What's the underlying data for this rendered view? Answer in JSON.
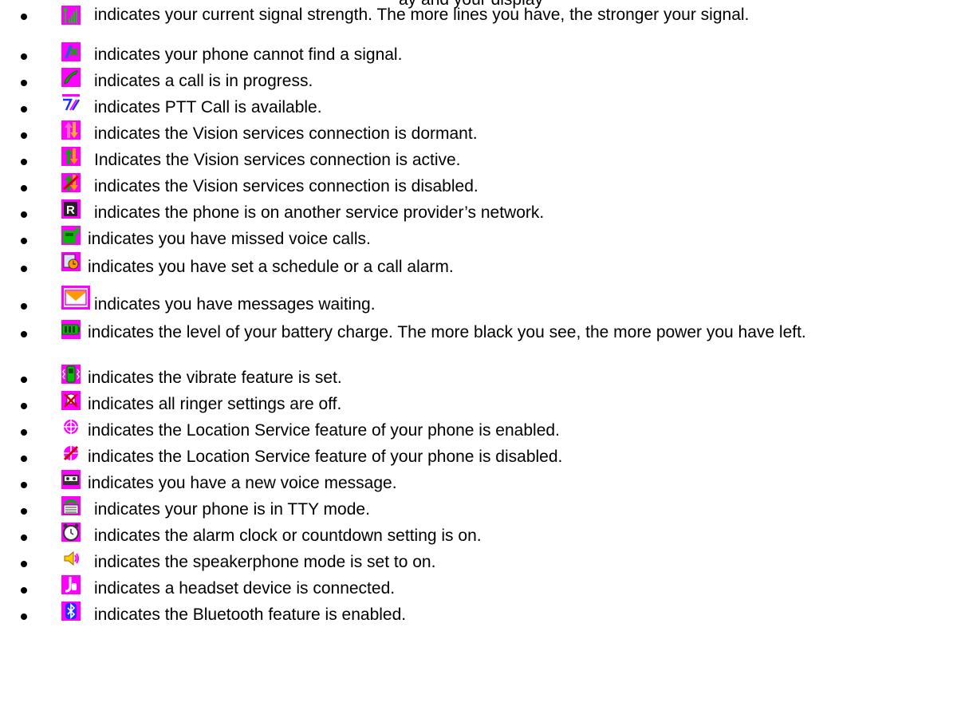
{
  "top_fragment": "ay and  your display",
  "items": [
    {
      "icon": "signal-strength-icon",
      "text": "indicates your current signal strength. The more lines you have, the stronger your signal."
    },
    {
      "icon": "no-signal-icon",
      "text": "indicates your phone cannot find a signal."
    },
    {
      "icon": "call-in-progress-icon",
      "text": "indicates a call is in progress."
    },
    {
      "icon": "ptt-call-icon",
      "text": "indicates PTT Call is available."
    },
    {
      "icon": "vision-dormant-icon",
      "text": "indicates the Vision services connection is dormant."
    },
    {
      "icon": "vision-active-icon",
      "text": "Indicates the Vision services connection is active."
    },
    {
      "icon": "vision-disabled-icon",
      "text": "indicates the Vision services connection is disabled."
    },
    {
      "icon": "roaming-icon",
      "text": "indicates the phone is on another service provider’s network."
    },
    {
      "icon": "missed-call-icon",
      "text": "indicates you have missed voice calls."
    },
    {
      "icon": "schedule-alarm-icon",
      "text": "indicates you have set a schedule or a call alarm."
    },
    {
      "icon": "message-envelope-icon",
      "text": "indicates you have messages waiting."
    },
    {
      "icon": "battery-icon",
      "text": "indicates the level of your battery charge. The more black you see, the more power you have left."
    },
    {
      "icon": "vibrate-icon",
      "text": "indicates the vibrate feature is set."
    },
    {
      "icon": "ringer-off-icon",
      "text": "indicates all ringer settings are off."
    },
    {
      "icon": "location-on-icon",
      "text": "indicates the Location Service feature of your phone is enabled."
    },
    {
      "icon": "location-off-icon",
      "text": "indicates the Location Service feature of your phone is disabled."
    },
    {
      "icon": "voicemail-icon",
      "text": "indicates you have a new voice message."
    },
    {
      "icon": "tty-icon",
      "text": "indicates your phone is in TTY mode."
    },
    {
      "icon": "alarm-clock-icon",
      "text": "indicates the alarm clock or countdown setting is on."
    },
    {
      "icon": "speakerphone-icon",
      "text": "indicates the speakerphone mode is set to on."
    },
    {
      "icon": "headset-icon",
      "text": "indicates a headset device is connected."
    },
    {
      "icon": "bluetooth-icon",
      "text": "indicates the Bluetooth feature is enabled."
    }
  ],
  "colors": {
    "magenta": "#ff00ff",
    "green": "#00a000",
    "blue": "#1e2fff",
    "orange": "#ff9900",
    "text": "#000000"
  }
}
